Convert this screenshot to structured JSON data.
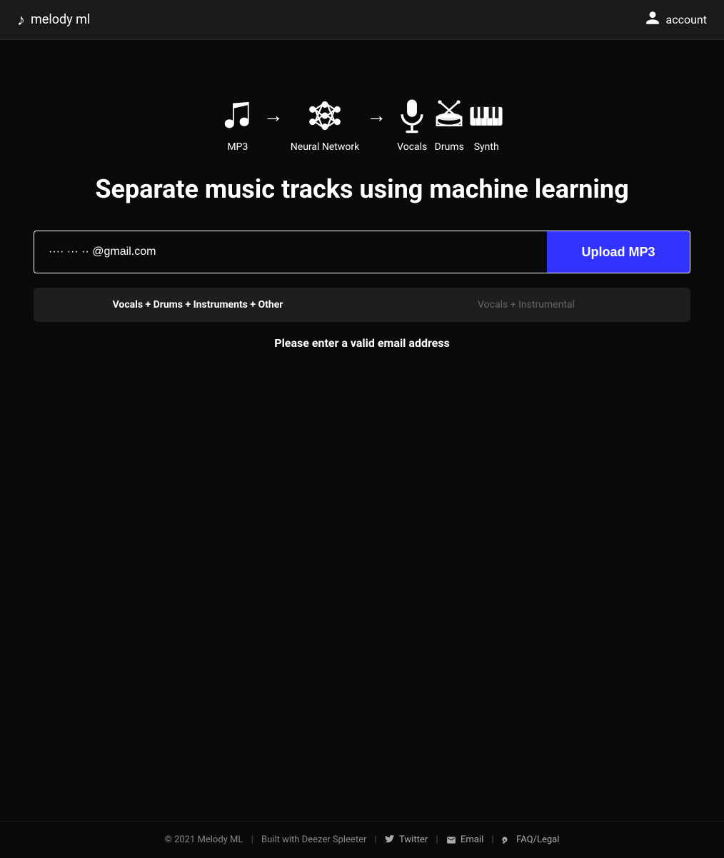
{
  "header": {
    "logo_icon": "♪",
    "logo_text": "melody ml",
    "account_label": "account"
  },
  "diagram": {
    "items": [
      {
        "id": "mp3",
        "label": "MP3"
      },
      {
        "id": "neural-network",
        "label": "Neural Network"
      },
      {
        "id": "vocals",
        "label": "Vocals"
      },
      {
        "id": "drums",
        "label": "Drums"
      },
      {
        "id": "synth",
        "label": "Synth"
      }
    ],
    "arrows": [
      "→",
      "→"
    ]
  },
  "main": {
    "heading": "Separate music tracks using machine learning",
    "email_placeholder": "···· ··· ·· @gmail.com",
    "email_value": "",
    "upload_button_label": "Upload MP3",
    "tabs": [
      {
        "id": "vocals-drums",
        "label": "Vocals + Drums + Instruments + Other",
        "active": true
      },
      {
        "id": "vocals-instrumental",
        "label": "Vocals + Instrumental",
        "active": false
      }
    ],
    "validation_message": "Please enter a valid email address"
  },
  "footer": {
    "copyright": "© 2021 Melody ML",
    "built_with": "Built with Deezer Spleeter",
    "twitter_label": "Twitter",
    "email_label": "Email",
    "faq_label": "FAQ/Legal"
  }
}
